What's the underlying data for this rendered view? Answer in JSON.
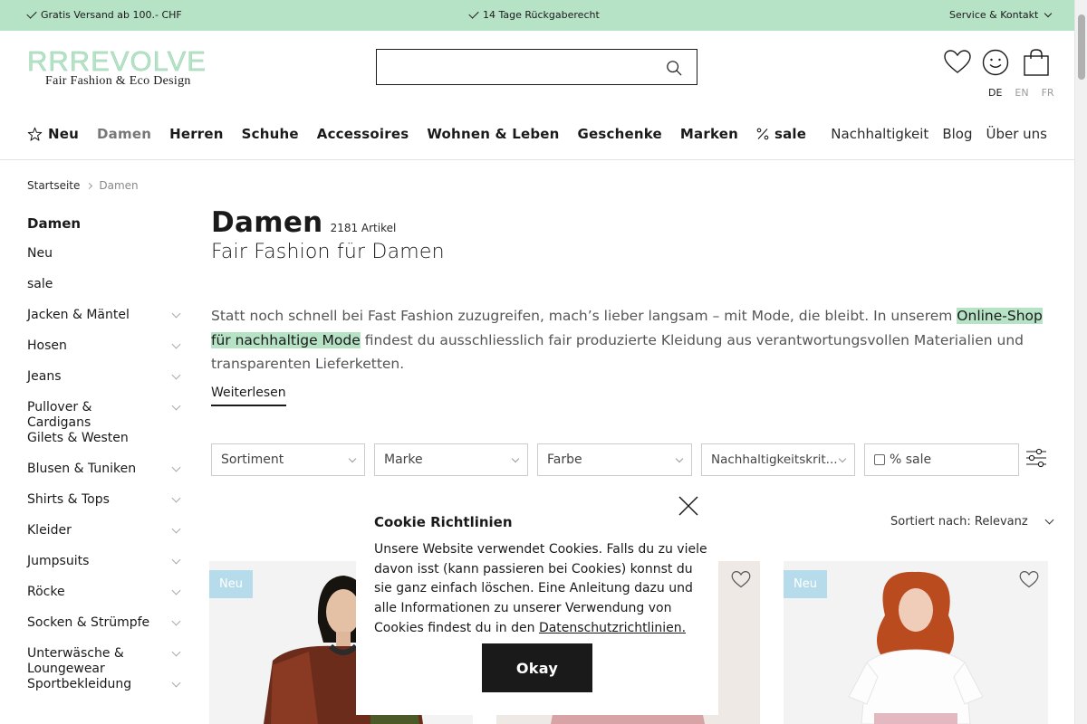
{
  "topbar": {
    "shipping": "Gratis Versand ab 100.- CHF",
    "returns": "14 Tage Rückgaberecht",
    "service": "Service & Kontakt"
  },
  "header": {
    "logo_text": "RRREVOLVE",
    "logo_tagline": "Fair Fashion & Eco Design",
    "search_placeholder": "",
    "languages": [
      "DE",
      "EN",
      "FR"
    ],
    "active_language": "DE"
  },
  "nav": {
    "items": [
      "Neu",
      "Damen",
      "Herren",
      "Schuhe",
      "Accessoires",
      "Wohnen & Leben",
      "Geschenke",
      "Marken",
      "sale"
    ],
    "right": [
      "Nachhaltigkeit",
      "Blog",
      "Über uns"
    ]
  },
  "breadcrumb": [
    "Startseite",
    "Damen"
  ],
  "sidebar": {
    "heading": "Damen",
    "items": [
      {
        "label": "Neu",
        "expandable": false
      },
      {
        "label": "sale",
        "expandable": false
      },
      {
        "label": "Jacken & Mäntel",
        "expandable": true
      },
      {
        "label": "Hosen",
        "expandable": true
      },
      {
        "label": "Jeans",
        "expandable": true
      },
      {
        "label": "Pullover & Cardigans",
        "expandable": true
      },
      {
        "label": "Gilets & Westen",
        "expandable": false
      },
      {
        "label": "Blusen & Tuniken",
        "expandable": true
      },
      {
        "label": "Shirts & Tops",
        "expandable": true
      },
      {
        "label": "Kleider",
        "expandable": true
      },
      {
        "label": "Jumpsuits",
        "expandable": true
      },
      {
        "label": "Röcke",
        "expandable": true
      },
      {
        "label": "Socken & Strümpfe",
        "expandable": true
      },
      {
        "label": "Unterwäsche & Loungewear",
        "expandable": true
      },
      {
        "label": "Sportbekleidung",
        "expandable": true
      }
    ]
  },
  "main": {
    "title": "Damen",
    "count": "2181 Artikel",
    "subtitle": "Fair Fashion für Damen",
    "intro_before": "Statt noch schnell bei Fast Fashion zuzugreifen, mach’s lieber langsam – mit Mode, die bleibt. In unserem ",
    "intro_link": "Online-Shop für nachhaltige Mode",
    "intro_after": " findest du ausschliesslich fair produzierte Kleidung aus verantwortungsvollen Materialien und transparenten Lieferketten.",
    "read_more": "Weiterlesen"
  },
  "filters": {
    "sortiment": "Sortiment",
    "marke": "Marke",
    "farbe": "Farbe",
    "nachhaltigkeit": "Nachhaltigkeitskrit...",
    "sale": "% sale",
    "sort_label": "Sortiert nach: Relevanz"
  },
  "products": [
    {
      "badge": "Neu"
    },
    {
      "badge": ""
    },
    {
      "badge": "Neu"
    }
  ],
  "cookie": {
    "title": "Cookie Richtlinien",
    "text": "Unsere Website verwendet Cookies. Falls du zu viele davon isst (kann passieren bei Cookies) konnst du sie ganz einfach löschen. Eine Anleitung dazu und alle Informationen zu unserer Verwendung von Cookies findest du in den ",
    "link": "Datenschutzrichtlinien.",
    "button": "Okay"
  },
  "colors": {
    "accent": "#b6e2c6",
    "badge": "#b6dcec",
    "dark": "#1a1a1a"
  },
  "icons": [
    "check-icon",
    "chevron-down-icon",
    "search-icon",
    "heart-icon",
    "smiley-icon",
    "bag-icon",
    "sparkle-icon",
    "percent-icon",
    "close-icon",
    "filter-settings-icon"
  ]
}
